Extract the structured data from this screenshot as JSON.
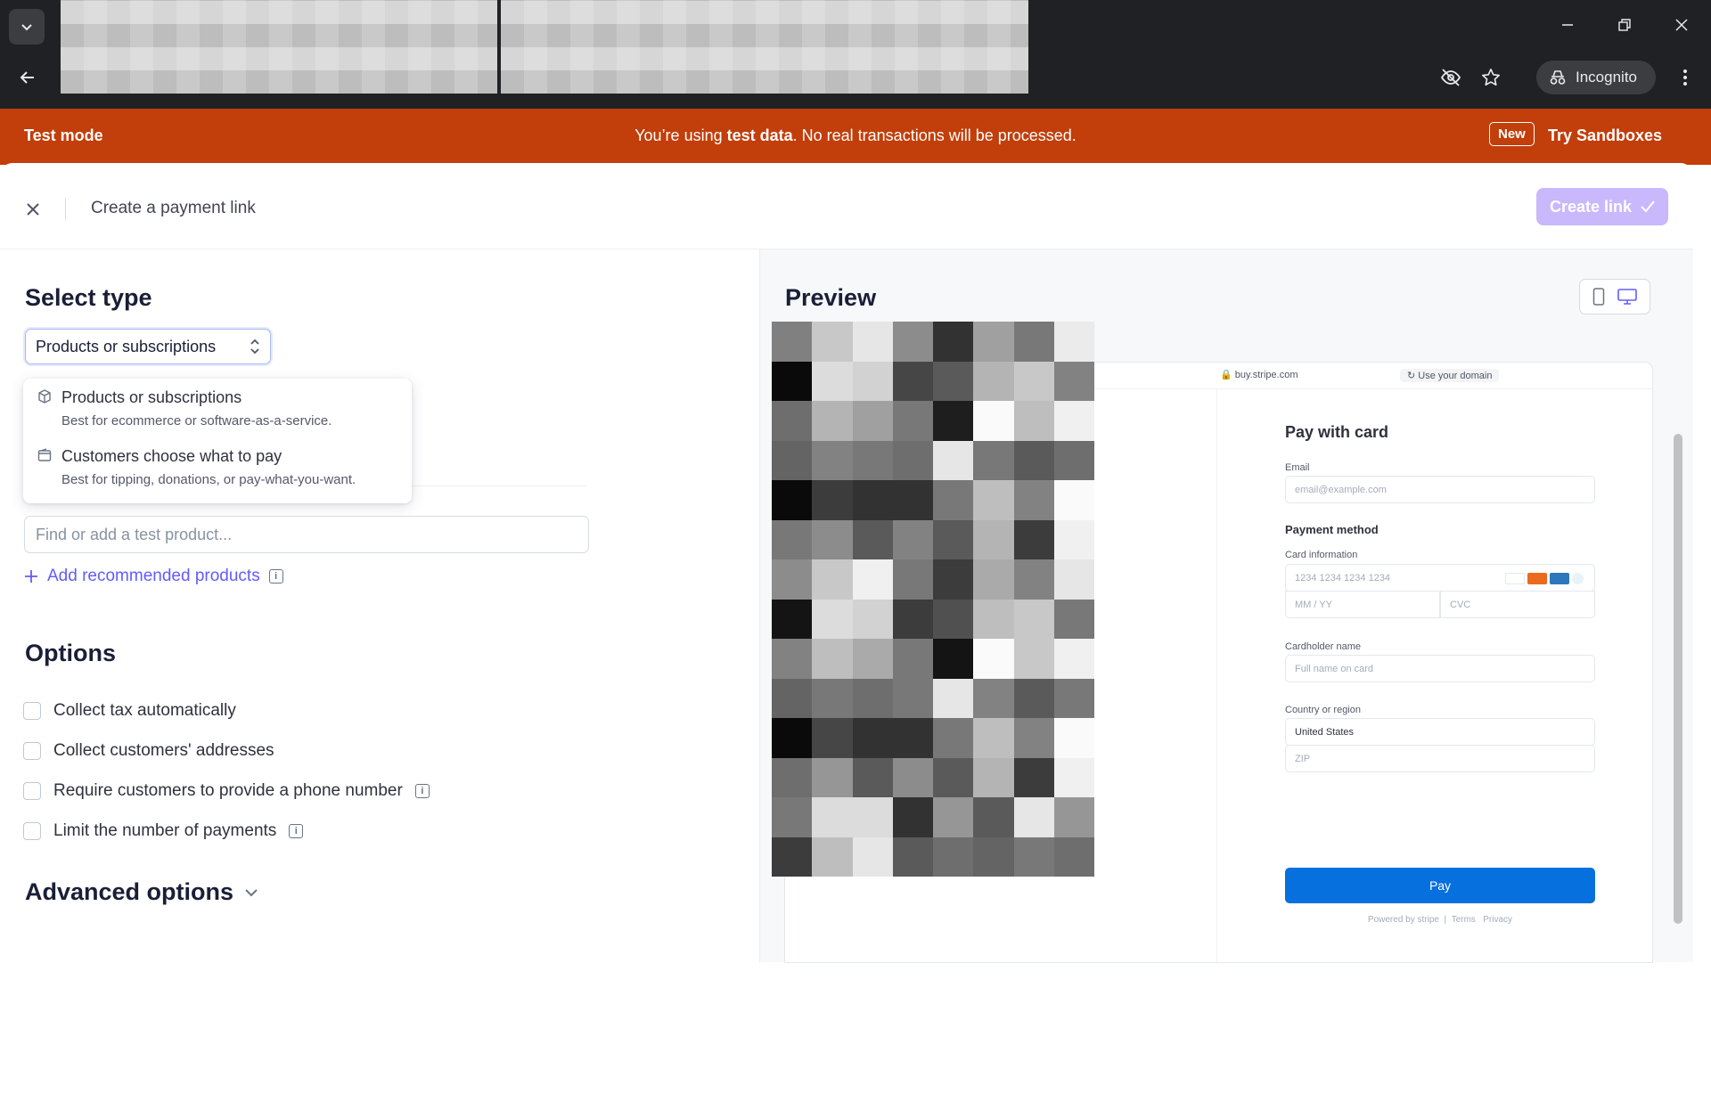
{
  "browser": {
    "incognito_label": "Incognito"
  },
  "banner": {
    "label": "Test mode",
    "message_prefix": "You’re using ",
    "message_bold": "test data",
    "message_suffix": ". No real transactions will be processed.",
    "new_badge": "New",
    "sandbox_link": "Try Sandboxes"
  },
  "header": {
    "title": "Create a payment link",
    "create_button": "Create link"
  },
  "form": {
    "select_type_heading": "Select type",
    "type_value": "Products or subscriptions",
    "menu": [
      {
        "title": "Products or subscriptions",
        "subtitle": "Best for ecommerce or software-as-a-service."
      },
      {
        "title": "Customers choose what to pay",
        "subtitle": "Best for tipping, donations, or pay-what-you-want."
      }
    ],
    "product_placeholder": "Find or add a test product...",
    "add_recommended": "Add recommended products",
    "options_heading": "Options",
    "options": [
      {
        "label": "Collect tax automatically",
        "checked": false
      },
      {
        "label": "Collect customers' addresses",
        "checked": false
      },
      {
        "label": "Require customers to provide a phone number",
        "checked": false
      },
      {
        "label": "Limit the number of payments",
        "checked": false
      }
    ],
    "advanced_heading": "Advanced options"
  },
  "preview": {
    "heading": "Preview",
    "url": "buy.stripe.com",
    "domain_button": "Use your domain",
    "checkout": {
      "title": "Pay with card",
      "email_label": "Email",
      "email_placeholder": "email@example.com",
      "payment_method_label": "Payment method",
      "card_info_label": "Card information",
      "card_number_placeholder": "1234 1234 1234 1234",
      "expiry_placeholder": "MM / YY",
      "cvc_placeholder": "CVC",
      "cardholder_label": "Cardholder name",
      "cardholder_placeholder": "Full name on card",
      "country_label": "Country or region",
      "country_value": "United States",
      "zip_placeholder": "ZIP",
      "pay_button": "Pay",
      "powered_by": "Powered by stripe",
      "terms": "Terms",
      "privacy": "Privacy"
    }
  },
  "colors": {
    "banner": "#c23e0a",
    "accent": "#635bff",
    "create_button_disabled": "#c9b8fb",
    "pay_button": "#0570de"
  }
}
